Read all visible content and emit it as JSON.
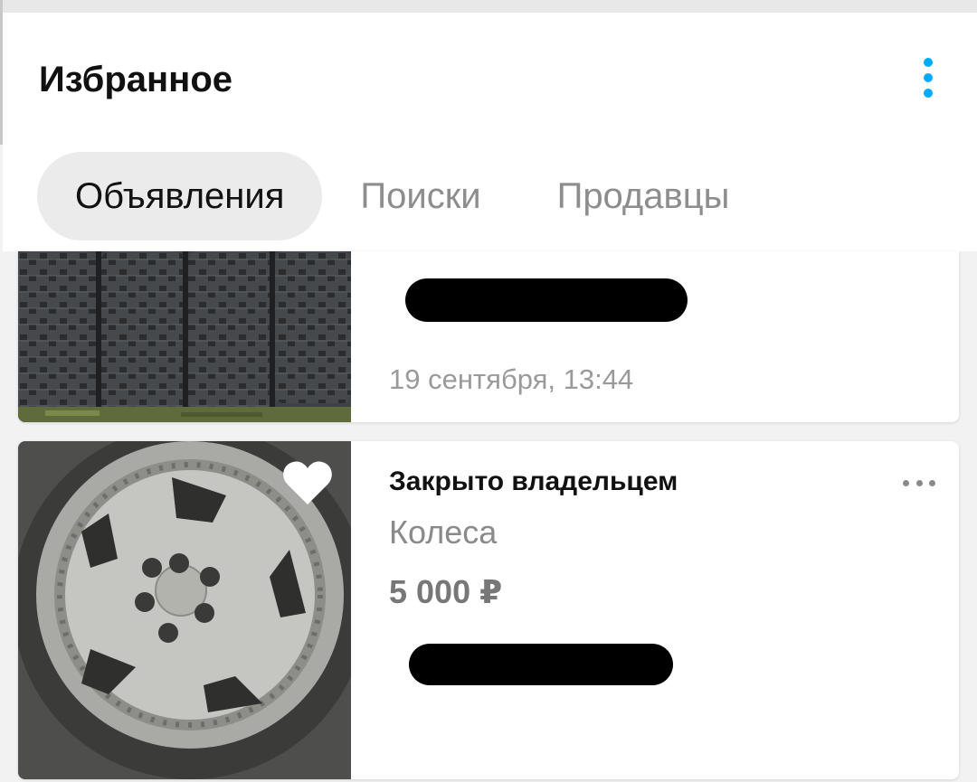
{
  "header": {
    "title": "Избранное",
    "menu_icon": "vertical-dots-icon",
    "accent_color": "#00aaff"
  },
  "tabs": [
    {
      "label": "Объявления",
      "active": true
    },
    {
      "label": "Поиски",
      "active": false
    },
    {
      "label": "Продавцы",
      "active": false
    }
  ],
  "listings": [
    {
      "image": "winter-tires-photo",
      "date": "19 сентября, 13:44"
    },
    {
      "image": "alloy-wheel-photo",
      "status": "Закрыто владельцем",
      "title": "Колеса",
      "price": "5 000 ₽",
      "favorite_icon": "heart-icon",
      "more_icon": "horizontal-dots-icon"
    }
  ]
}
